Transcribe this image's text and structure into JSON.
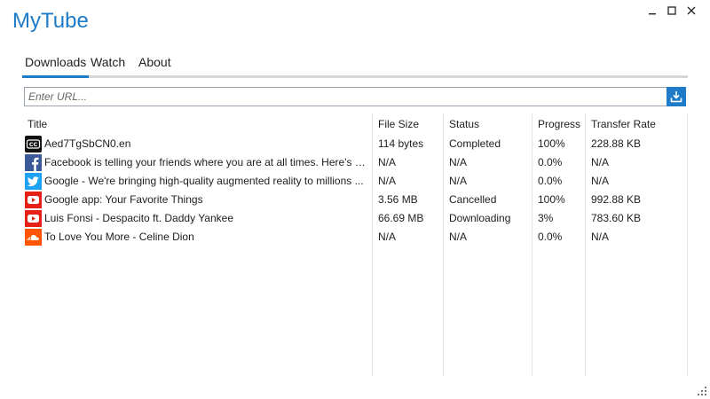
{
  "app": {
    "title": "MyTube"
  },
  "tabs": [
    {
      "label": "Downloads",
      "active": true
    },
    {
      "label": "Watch",
      "active": false
    },
    {
      "label": "About",
      "active": false
    }
  ],
  "url_bar": {
    "placeholder": "Enter URL...",
    "value": ""
  },
  "table": {
    "headers": {
      "title": "Title",
      "file_size": "File Size",
      "status": "Status",
      "progress": "Progress",
      "transfer_rate": "Transfer Rate"
    },
    "rows": [
      {
        "icon": "closed-caption-icon",
        "title": "Aed7TgSbCN0.en",
        "file_size": "114 bytes",
        "status": "Completed",
        "progress": "100%",
        "transfer_rate": "228.88 KB"
      },
      {
        "icon": "facebook-icon",
        "title": "Facebook is telling your friends where you are at all times. Here's ho...",
        "file_size": "N/A",
        "status": "N/A",
        "progress": "0.0%",
        "transfer_rate": "N/A"
      },
      {
        "icon": "twitter-icon",
        "title": "Google - We're bringing high-quality augmented reality to millions ...",
        "file_size": "N/A",
        "status": "N/A",
        "progress": "0.0%",
        "transfer_rate": "N/A"
      },
      {
        "icon": "youtube-icon",
        "title": "Google app: Your Favorite Things",
        "file_size": "3.56 MB",
        "status": "Cancelled",
        "progress": "100%",
        "transfer_rate": "992.88 KB"
      },
      {
        "icon": "youtube-icon",
        "title": "Luis Fonsi - Despacito ft. Daddy Yankee",
        "file_size": "66.69 MB",
        "status": "Downloading",
        "progress": "3%",
        "transfer_rate": "783.60 KB"
      },
      {
        "icon": "soundcloud-icon",
        "title": "To Love You More - Celine Dion",
        "file_size": "N/A",
        "status": "N/A",
        "progress": "0.0%",
        "transfer_rate": "N/A"
      }
    ]
  },
  "colors": {
    "accent": "#1e7bc8",
    "facebook": "#3b5998",
    "twitter": "#1da1f2",
    "youtube": "#e62117",
    "soundcloud": "#ff5500",
    "cc": "#111111"
  }
}
